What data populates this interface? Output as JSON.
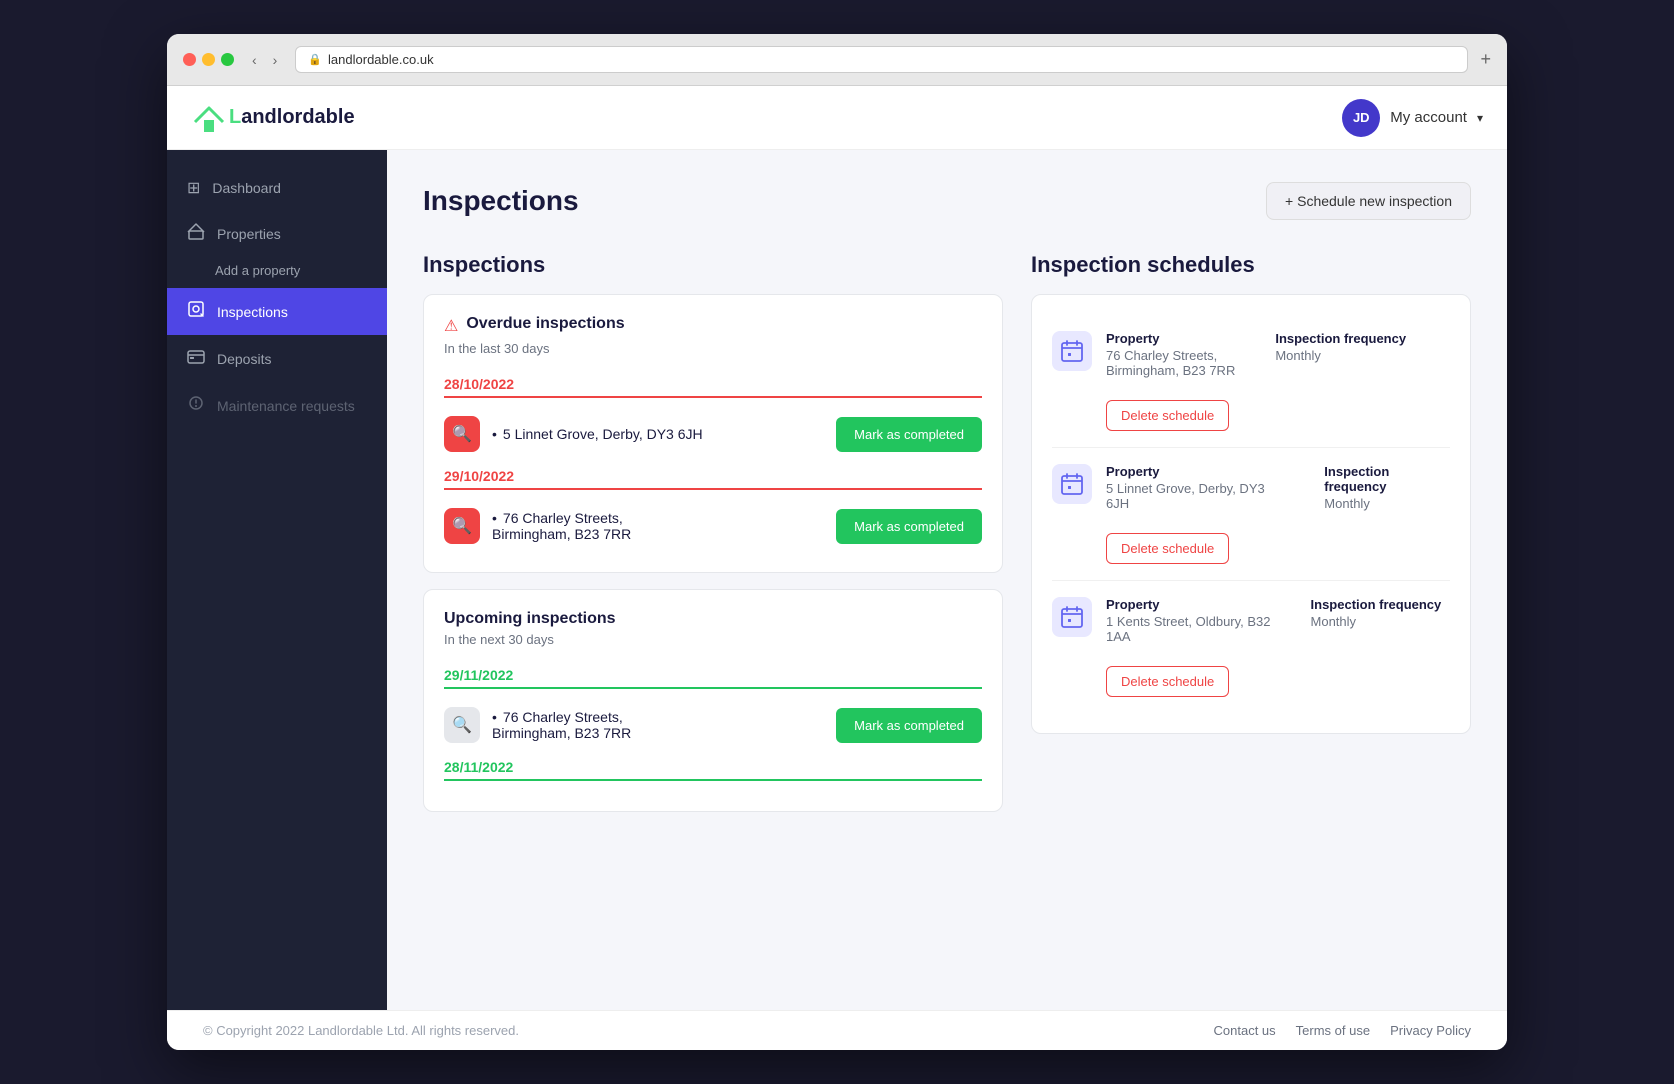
{
  "browser": {
    "url": "landlordable.co.uk",
    "new_tab_label": "+"
  },
  "nav": {
    "logo_text_L": "L",
    "logo_text_rest": "andlordable",
    "account_initials": "JD",
    "account_label": "My account"
  },
  "sidebar": {
    "items": [
      {
        "id": "dashboard",
        "label": "Dashboard",
        "icon": "⊞",
        "active": false
      },
      {
        "id": "properties",
        "label": "Properties",
        "icon": "🏠",
        "active": false
      },
      {
        "id": "properties-sub",
        "label": "Add a property",
        "icon": "",
        "active": false,
        "sub": true
      },
      {
        "id": "inspections",
        "label": "Inspections",
        "icon": "🔍",
        "active": true
      },
      {
        "id": "deposits",
        "label": "Deposits",
        "icon": "🏛",
        "active": false
      },
      {
        "id": "maintenance",
        "label": "Maintenance requests",
        "icon": "⚙",
        "active": false,
        "disabled": true
      }
    ]
  },
  "page": {
    "title": "Inspections",
    "schedule_btn": "+ Schedule new inspection"
  },
  "inspections_section": {
    "title": "Inspections",
    "overdue_card": {
      "title": "Overdue inspections",
      "subtitle": "In the last 30 days",
      "groups": [
        {
          "date": "28/10/2022",
          "type": "red",
          "items": [
            {
              "address": "5 Linnet Grove, Derby, DY3 6JH",
              "btn": "Mark as completed"
            }
          ]
        },
        {
          "date": "29/10/2022",
          "type": "red",
          "items": [
            {
              "address": "76 Charley Streets, Birmingham, B23 7RR",
              "btn": "Mark as completed"
            }
          ]
        }
      ]
    },
    "upcoming_card": {
      "title": "Upcoming inspections",
      "subtitle": "In the next 30 days",
      "groups": [
        {
          "date": "29/11/2022",
          "type": "green",
          "items": [
            {
              "address": "76 Charley Streets, Birmingham, B23 7RR",
              "btn": "Mark as completed"
            }
          ]
        },
        {
          "date": "28/11/2022",
          "type": "green",
          "items": []
        }
      ]
    }
  },
  "schedules_section": {
    "title": "Inspection schedules",
    "items": [
      {
        "prop_label": "Property",
        "address": "76 Charley Streets, Birmingham, B23 7RR",
        "freq_label": "Inspection frequency",
        "freq_value": "Monthly",
        "delete_btn": "Delete schedule"
      },
      {
        "prop_label": "Property",
        "address": "5 Linnet Grove, Derby, DY3 6JH",
        "freq_label": "Inspection frequency",
        "freq_value": "Monthly",
        "delete_btn": "Delete schedule"
      },
      {
        "prop_label": "Property",
        "address": "1 Kents Street, Oldbury, B32 1AA",
        "freq_label": "Inspection frequency",
        "freq_value": "Monthly",
        "delete_btn": "Delete schedule"
      }
    ]
  },
  "footer": {
    "copyright": "© Copyright 2022 Landlordable Ltd. All rights reserved.",
    "links": [
      "Contact us",
      "Terms of use",
      "Privacy Policy"
    ]
  }
}
